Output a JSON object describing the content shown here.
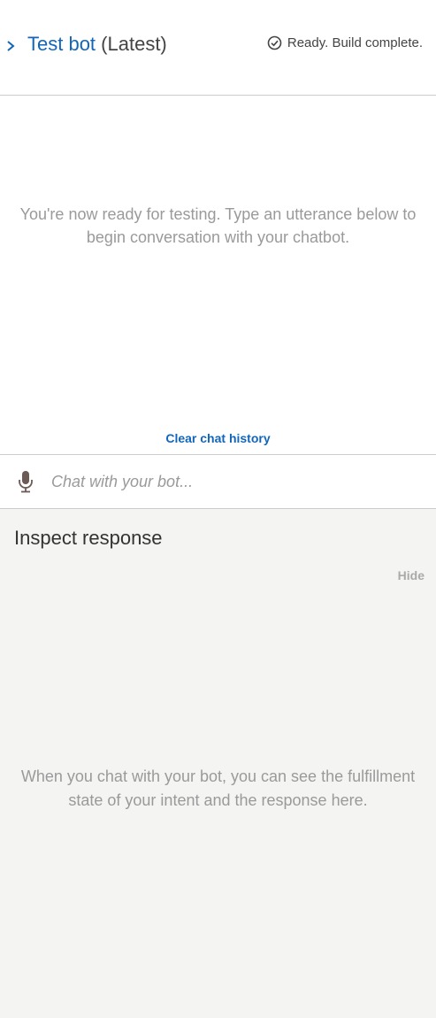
{
  "header": {
    "title_link": "Test bot",
    "title_version": "(Latest)",
    "status_text": "Ready. Build complete.",
    "status_icon": "check-circle-icon",
    "chevron_icon": "chevron-right-icon"
  },
  "chat": {
    "empty_message": "You're now ready for testing. Type an utterance below to begin conversation with your chatbot.",
    "clear_history_label": "Clear chat history",
    "input_placeholder": "Chat with your bot...",
    "input_value": "",
    "mic_icon": "microphone-icon"
  },
  "inspect": {
    "title": "Inspect response",
    "hide_label": "Hide",
    "empty_message": "When you chat with your bot, you can see the fulfillment state of your intent and the response here."
  },
  "colors": {
    "link": "#1166bb",
    "muted_text": "#9a9a9a",
    "inspect_background": "#f4f4f2",
    "divider": "#cccccc"
  }
}
